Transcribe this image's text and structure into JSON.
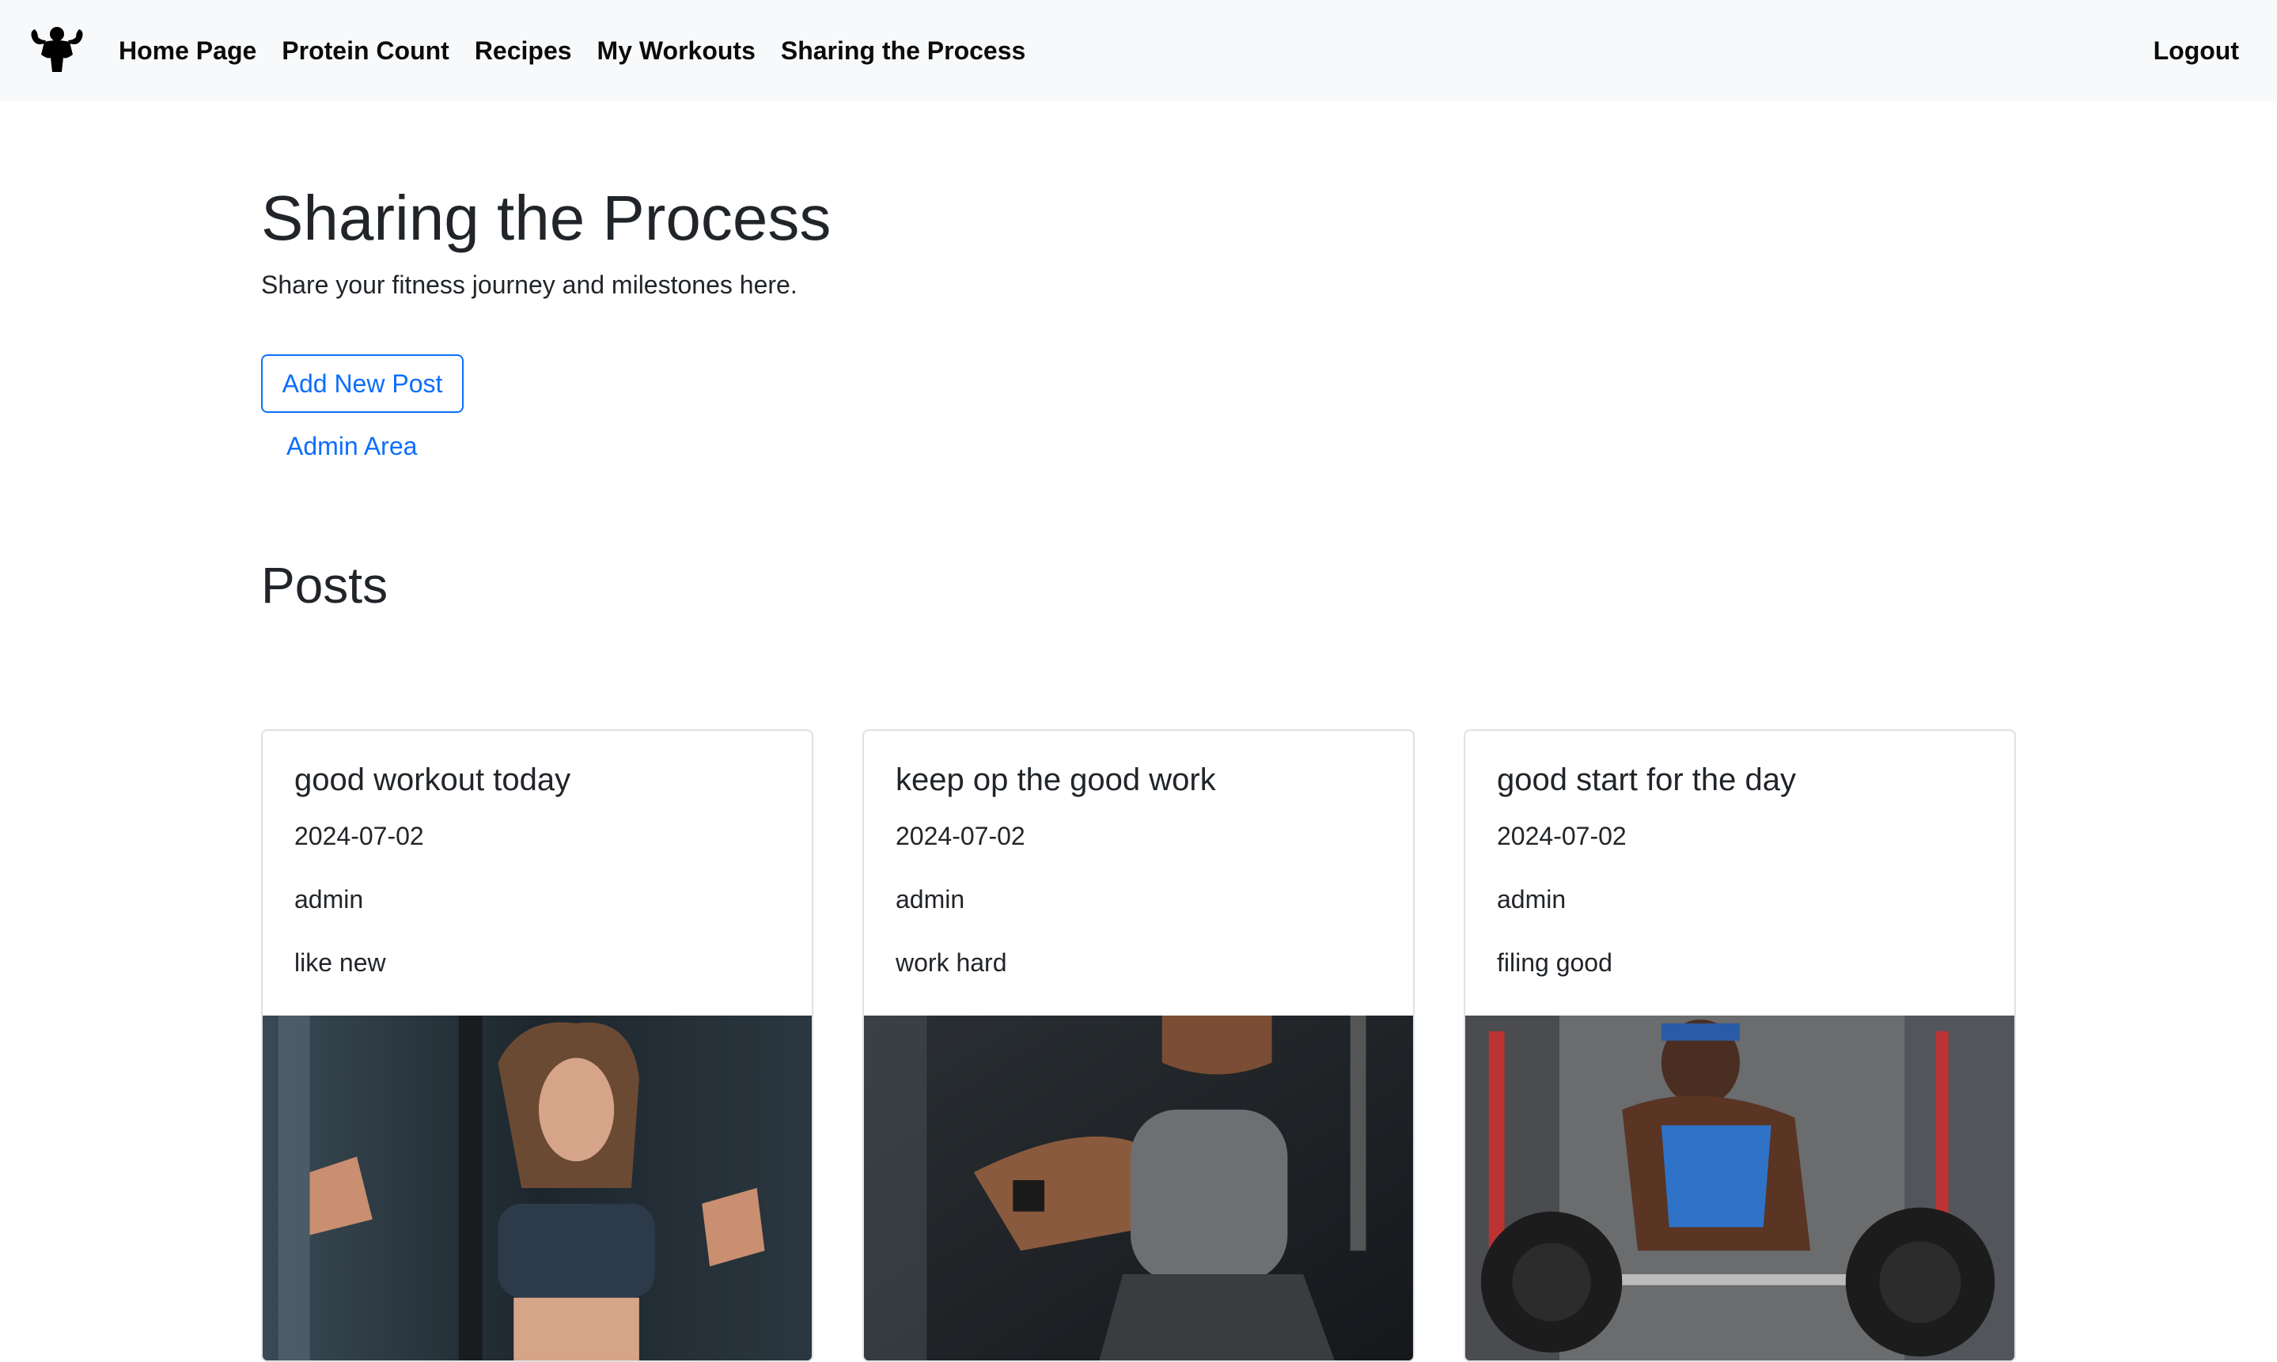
{
  "nav": {
    "logo_icon": "flexing-bodybuilder-icon",
    "links": [
      "Home Page",
      "Protein Count",
      "Recipes",
      "My Workouts",
      "Sharing the Process"
    ],
    "logout": "Logout"
  },
  "header": {
    "title": "Sharing the Process",
    "subtitle": "Share your fitness journey and milestones here."
  },
  "actions": {
    "add_post": "Add New Post",
    "admin_area": "Admin Area"
  },
  "posts_section": {
    "title": "Posts",
    "items": [
      {
        "title": "good workout today",
        "date": "2024-07-02",
        "author": "admin",
        "content": "like new"
      },
      {
        "title": "keep op the good work",
        "date": "2024-07-02",
        "author": "admin",
        "content": "work hard"
      },
      {
        "title": "good start for the day",
        "date": "2024-07-02",
        "author": "admin",
        "content": "filing good"
      }
    ]
  },
  "colors": {
    "primary": "#0d6efd",
    "navbar_bg": "#f8f9fa",
    "text": "#212529"
  }
}
